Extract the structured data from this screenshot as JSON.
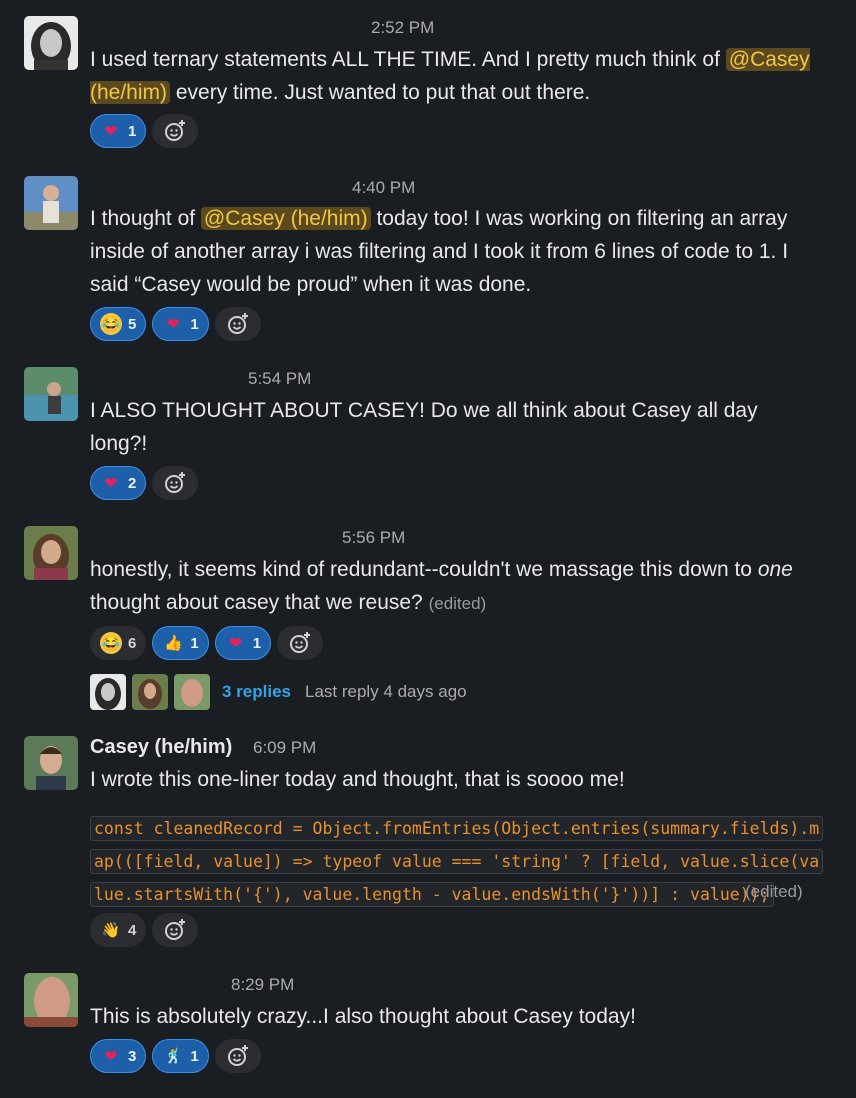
{
  "messages": [
    {
      "time": "2:52 PM",
      "pre": "I used ternary statements ALL THE TIME. And I pretty much think of ",
      "mention": "@Casey (he/him)",
      "post": " every time. Just wanted to put that out there.",
      "reactions": [
        {
          "emoji": "heart",
          "count": "1"
        }
      ]
    },
    {
      "time": "4:40 PM",
      "pre": "I thought of ",
      "mention": "@Casey (he/him)",
      "post": " today too! I was working on filtering an array inside of another array i was filtering and I took it from 6 lines of code to 1. I said “Casey would be proud” when it was done.",
      "reactions": [
        {
          "emoji": "joy",
          "count": "5"
        },
        {
          "emoji": "heart",
          "count": "1"
        }
      ]
    },
    {
      "time": "5:54 PM",
      "text": "I ALSO THOUGHT ABOUT CASEY!  Do we all think about Casey all day long?!",
      "reactions": [
        {
          "emoji": "heart",
          "count": "2"
        }
      ]
    },
    {
      "time": "5:56 PM",
      "pre": "honestly, it seems kind of redundant--couldn't we massage this down to ",
      "em": "one",
      "post": " thought about casey that we reuse?",
      "edited": "(edited)",
      "reactions": [
        {
          "emoji": "joy",
          "count": "6"
        },
        {
          "emoji": "thumbsup",
          "count": "1"
        },
        {
          "emoji": "heart",
          "count": "1"
        }
      ],
      "thread": {
        "replies": "3 replies",
        "last": "Last reply 4 days ago"
      }
    },
    {
      "name": "Casey (he/him)",
      "time": "6:09 PM",
      "text": "I wrote this one-liner today and thought, that is soooo me!",
      "code": "const cleanedRecord = Object.fromEntries(Object.entries(summary.fields).map(([field, value]) => typeof value === 'string' ? [field, value.slice(value.startsWith('{'), value.length - value.endsWith('}'))] : value));",
      "edited": "(edited)",
      "reactions": [
        {
          "emoji": "wave",
          "count": "4"
        }
      ]
    },
    {
      "time": "8:29 PM",
      "text": "This is absolutely crazy...I also thought about Casey today!",
      "reactions": [
        {
          "emoji": "heart",
          "count": "3"
        },
        {
          "emoji": "dancer",
          "count": "1"
        }
      ]
    }
  ],
  "colors": {
    "background": "#1a1d21",
    "mention_bg": "#5c4a1e",
    "mention_fg": "#f2c744",
    "link": "#36a3e8",
    "my_reaction": "#1d5fa8",
    "code": "#e8912d"
  }
}
